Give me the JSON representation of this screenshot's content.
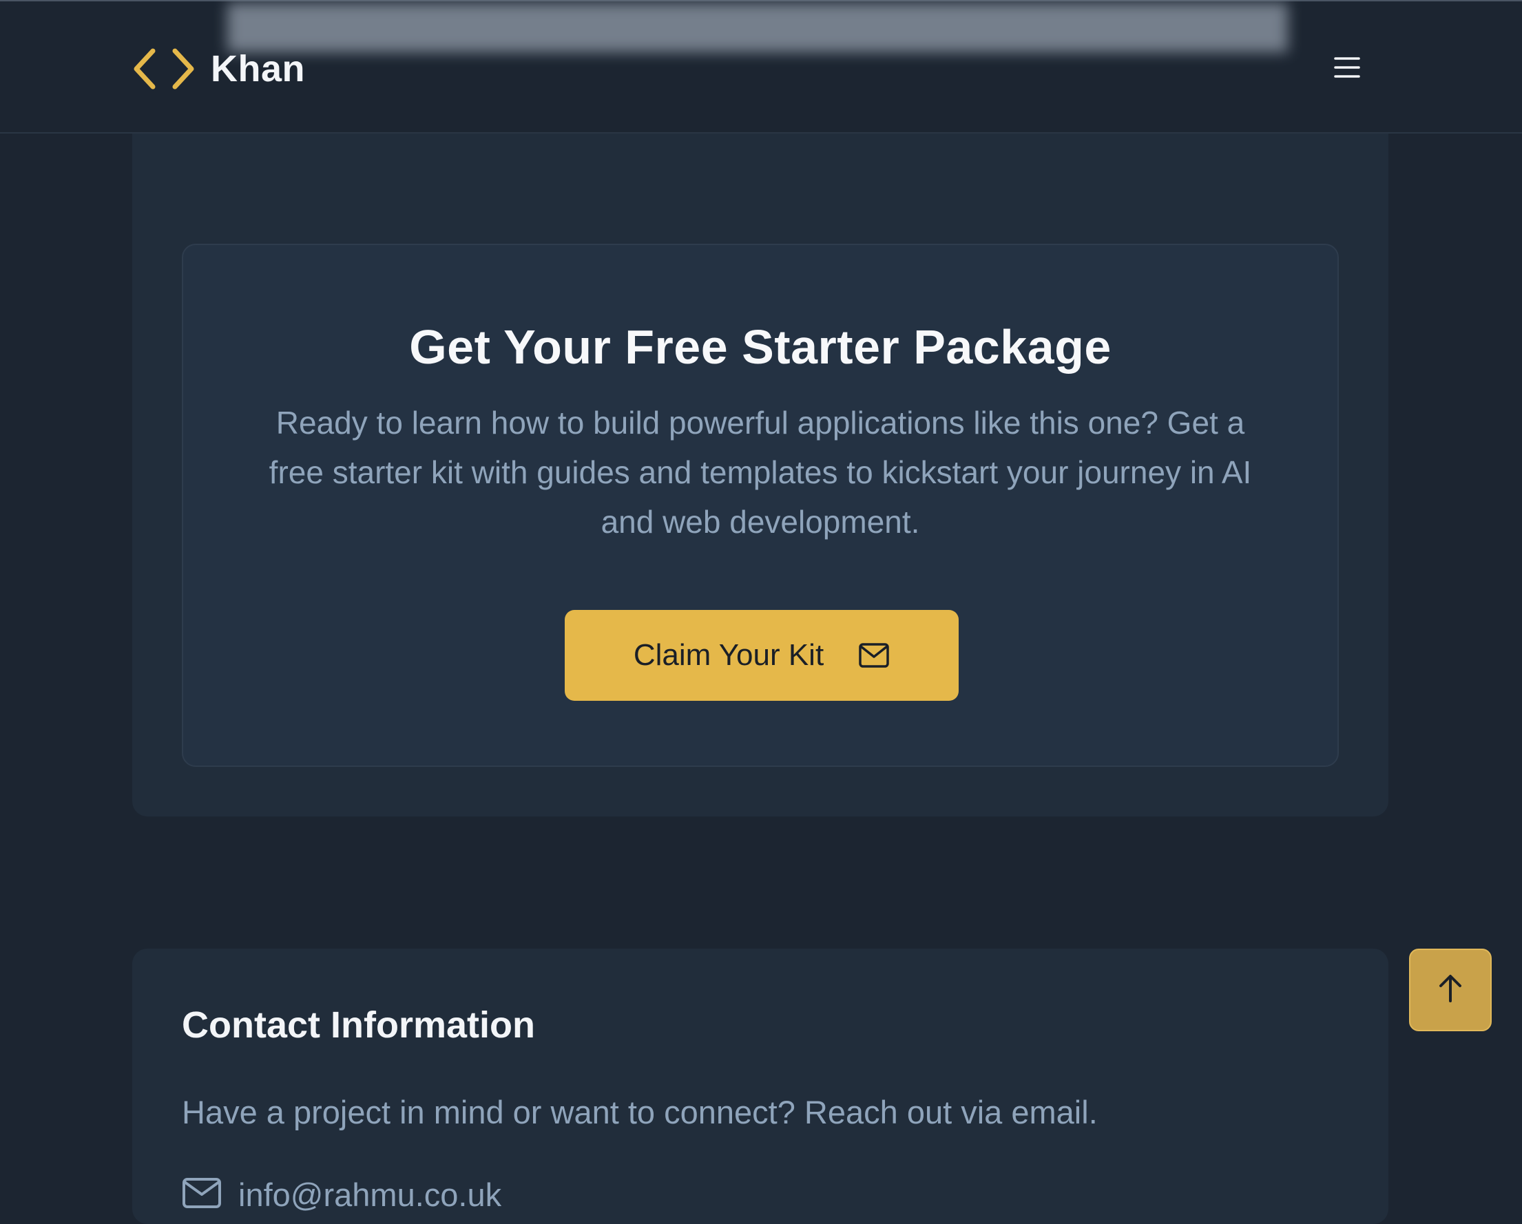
{
  "header": {
    "brand": "Khan",
    "logo_icon": "code-brackets-icon",
    "menu_icon": "hamburger-menu-icon"
  },
  "promo": {
    "title": "Get Your Free Starter Package",
    "description": "Ready to learn how to build powerful applications like this one? Get a free starter kit with guides and templates to kickstart your journey in AI and web development.",
    "button_label": "Claim Your Kit",
    "button_icon": "mail-icon"
  },
  "contact": {
    "title": "Contact Information",
    "description": "Have a project in mind or want to connect? Reach out via email.",
    "email": "info@rahmu.co.uk",
    "email_icon": "mail-icon"
  },
  "scroll_top": {
    "icon": "arrow-up-icon"
  },
  "colors": {
    "background": "#1c2531",
    "card": "#212d3b",
    "inner_card": "#243243",
    "accent": "#e5b84a",
    "muted_text": "#8fa4bb",
    "heading_text": "#f7f8fa"
  }
}
